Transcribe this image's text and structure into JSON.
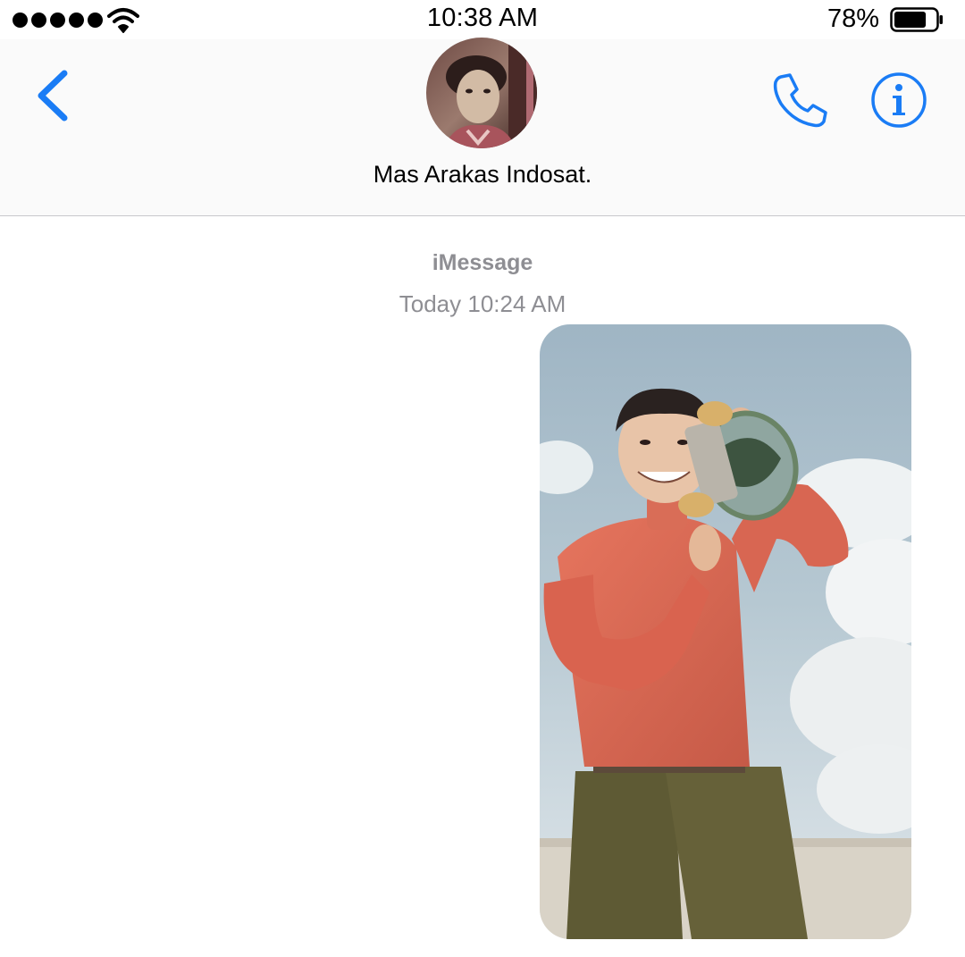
{
  "status_bar": {
    "signal_icon": "signal-dots-icon",
    "wifi_icon": "wifi-icon",
    "time": "10:38 AM",
    "battery_percent": "78%",
    "battery_level": 0.78,
    "battery_icon": "battery-icon"
  },
  "header": {
    "back_icon": "chevron-left-icon",
    "contact_name": "Mas Arakas Indosat.",
    "call_icon": "phone-icon",
    "info_icon": "info-icon",
    "accent_color": "#1a7cf5"
  },
  "conversation": {
    "service": "iMessage",
    "timestamp": "Today 10:24 AM",
    "messages": [
      {
        "type": "photo",
        "direction": "outgoing"
      }
    ]
  }
}
